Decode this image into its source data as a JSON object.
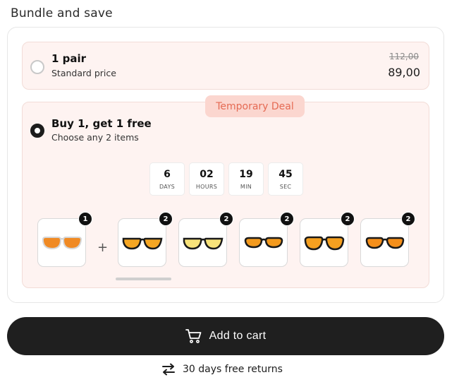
{
  "section_title": "Bundle and save",
  "option1": {
    "title": "1 pair",
    "subtitle": "Standard price",
    "old_price": "112,00",
    "new_price": "89,00",
    "selected": false
  },
  "option2": {
    "title": "Buy 1, get 1 free",
    "subtitle": "Choose any 2 items",
    "badge": "Temporary Deal",
    "selected": true
  },
  "countdown": [
    {
      "value": "6",
      "label": "DAYS"
    },
    {
      "value": "02",
      "label": "HOURS"
    },
    {
      "value": "19",
      "label": "MIN"
    },
    {
      "value": "45",
      "label": "SEC"
    }
  ],
  "items": [
    {
      "count": "1",
      "frame": "clear",
      "lens": "#f08a24"
    },
    {
      "count": "2",
      "frame": "black",
      "lens": "#f5a623"
    },
    {
      "count": "2",
      "frame": "black",
      "lens": "#f7e27a"
    },
    {
      "count": "2",
      "frame": "black",
      "lens": "#f39a1e"
    },
    {
      "count": "2",
      "frame": "black",
      "lens": "#f5a020"
    },
    {
      "count": "2",
      "frame": "black",
      "lens": "#f58f1a"
    }
  ],
  "plus_sign": "+",
  "cart_button": {
    "label": "Add to cart",
    "icon": "cart-icon"
  },
  "returns": {
    "label": "30 days free returns",
    "icon": "swap-arrows-icon"
  },
  "colors": {
    "accent_bg": "#fef3f1",
    "badge_bg": "#fbd6cf",
    "badge_text": "#e56a53",
    "button_bg": "#1f1f1f"
  }
}
